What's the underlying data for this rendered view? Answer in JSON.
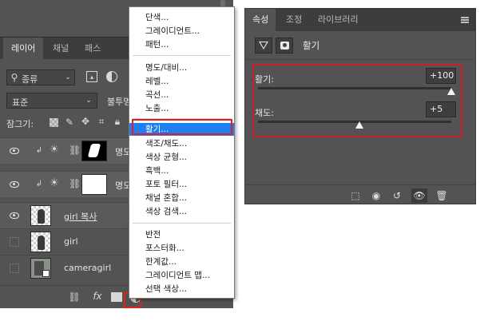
{
  "layers_panel": {
    "tabs": [
      "레이어",
      "채널",
      "패스"
    ],
    "filter": {
      "label": "종류"
    },
    "blend_mode": "표준",
    "opacity_label": "불투명",
    "lock_label": "잠그기:",
    "layers": [
      {
        "name": "명도",
        "kind": "adjustment",
        "thumb": "mask-black"
      },
      {
        "name": "명도",
        "kind": "adjustment",
        "thumb": "mask-white"
      },
      {
        "name": "girl 복사",
        "kind": "pixel",
        "visible": true
      },
      {
        "name": "girl",
        "kind": "pixel",
        "visible": false
      },
      {
        "name": "cameragirl",
        "kind": "smart",
        "visible": false
      }
    ],
    "bottom_icons": [
      "link-icon",
      "fx-icon",
      "mask-icon",
      "adjustment-icon",
      "folder-icon",
      "new-layer-icon",
      "trash-icon"
    ]
  },
  "adjustment_menu": {
    "groups": [
      [
        "단색...",
        "그레이디언트...",
        "패턴..."
      ],
      [
        "명도/대비...",
        "레벨...",
        "곡선...",
        "노출..."
      ],
      [
        "활기...",
        "색조/채도...",
        "색상 균형...",
        "흑백...",
        "포토 필터...",
        "채널 혼합...",
        "색상 검색..."
      ],
      [
        "반전",
        "포스터화...",
        "한계값...",
        "그레이디언트 맵...",
        "선택 색상..."
      ]
    ],
    "highlighted": "활기..."
  },
  "properties_panel": {
    "tabs": [
      "속성",
      "조정",
      "라이브러리"
    ],
    "title": "활기",
    "sliders": [
      {
        "label": "활기:",
        "value": "+100",
        "position": 1.0
      },
      {
        "label": "채도:",
        "value": "+5",
        "position": 0.525
      }
    ],
    "bottom_icons": [
      "clip-to-layer-icon",
      "view-previous-icon",
      "reset-icon",
      "visibility-icon",
      "trash-icon"
    ]
  }
}
